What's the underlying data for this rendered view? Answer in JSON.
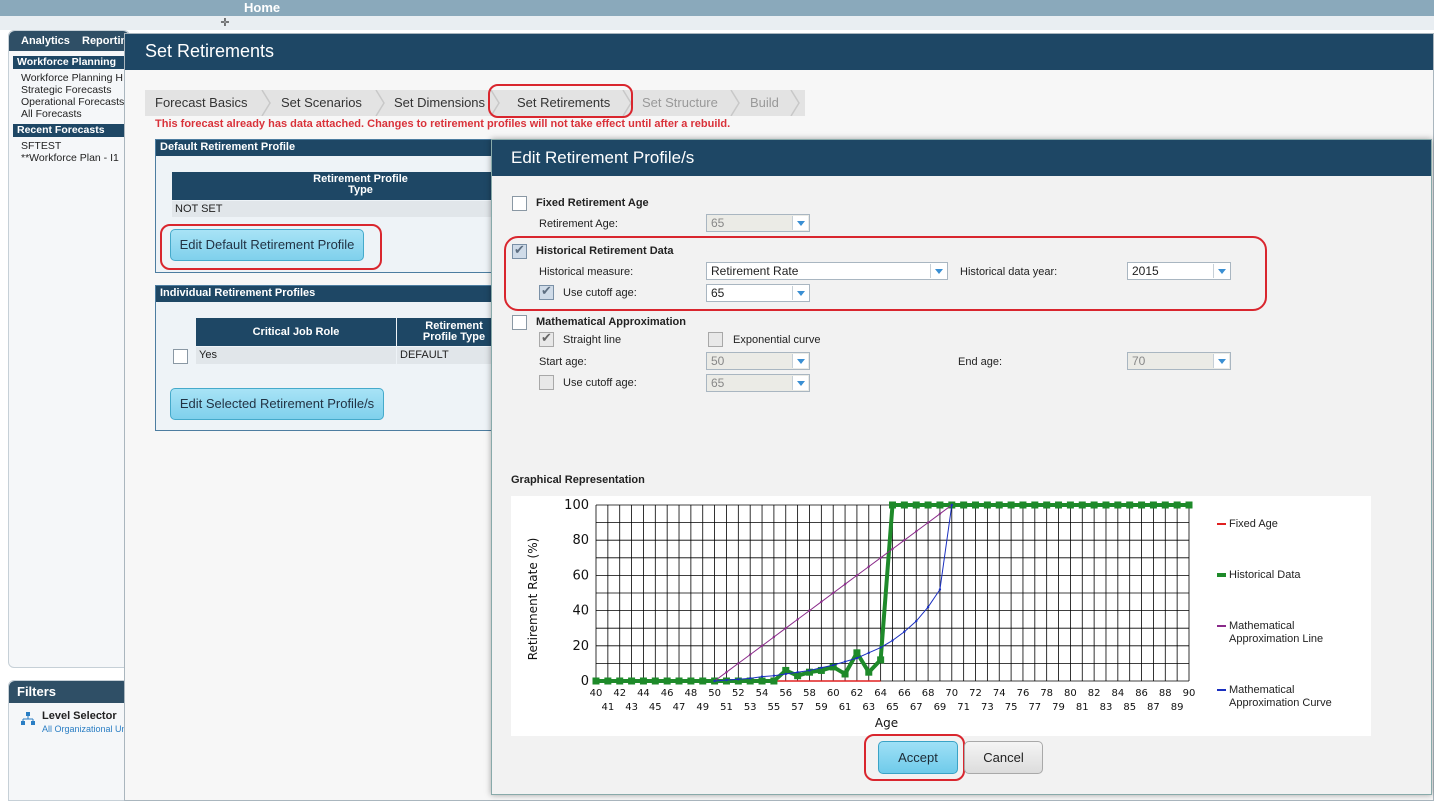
{
  "app": {
    "home_label": "Home"
  },
  "left_panel": {
    "tabs": [
      "Analytics",
      "Reporting"
    ],
    "section1_title": "Workforce Planning",
    "section1_items": [
      "Workforce Planning H",
      "Strategic Forecasts",
      "Operational Forecasts",
      "All Forecasts"
    ],
    "section2_title": "Recent Forecasts",
    "section2_items": [
      "SFTEST",
      "**Workforce Plan - I1"
    ]
  },
  "filters": {
    "title": "Filters",
    "level_selector_label": "Level Selector",
    "level_selector_value": "All Organizational Un"
  },
  "window": {
    "title": "Set Retirements",
    "breadcrumbs": [
      "Forecast Basics",
      "Set Scenarios",
      "Set Dimensions",
      "Set Retirements",
      "Set Structure",
      "Build"
    ],
    "warning": "This forecast already has data attached. Changes to retirement profiles will not take effect until after a rebuild."
  },
  "default_profile": {
    "title": "Default Retirement Profile",
    "column_header": "Retirement Profile Type",
    "value": "NOT SET",
    "button": "Edit Default Retirement Profile"
  },
  "individual_profiles": {
    "title": "Individual Retirement Profiles",
    "columns": [
      "Critical Job Role",
      "Retirement Profile Type"
    ],
    "rows": [
      {
        "role": "Yes",
        "type": "DEFAULT"
      }
    ],
    "button": "Edit Selected Retirement Profile/s"
  },
  "dialog": {
    "title": "Edit Retirement Profile/s",
    "fixed": {
      "label": "Fixed Retirement Age",
      "checked": false,
      "age_label": "Retirement Age:",
      "age_value": "65"
    },
    "historical": {
      "label": "Historical Retirement Data",
      "checked": true,
      "measure_label": "Historical measure:",
      "measure_value": "Retirement Rate",
      "year_label": "Historical data year:",
      "year_value": "2015",
      "cutoff_label": "Use cutoff age:",
      "cutoff_checked": true,
      "cutoff_value": "65"
    },
    "math": {
      "label": "Mathematical Approximation",
      "checked": false,
      "straight_label": "Straight line",
      "straight_checked": true,
      "exp_label": "Exponential curve",
      "exp_checked": false,
      "start_label": "Start age:",
      "start_value": "50",
      "end_label": "End age:",
      "end_value": "70",
      "cutoff_label": "Use cutoff age:",
      "cutoff_checked": false,
      "cutoff_value": "65"
    },
    "graph_title": "Graphical Representation",
    "accept_label": "Accept",
    "cancel_label": "Cancel"
  },
  "chart_data": {
    "type": "line",
    "xlabel": "Age",
    "ylabel": "Retirement Rate (%)",
    "xlim": [
      40,
      90
    ],
    "ylim": [
      0,
      100
    ],
    "yticks": [
      0,
      20,
      40,
      60,
      80,
      100
    ],
    "x": [
      40,
      41,
      42,
      43,
      44,
      45,
      46,
      47,
      48,
      49,
      50,
      51,
      52,
      53,
      54,
      55,
      56,
      57,
      58,
      59,
      60,
      61,
      62,
      63,
      64,
      65,
      66,
      67,
      68,
      69,
      70,
      71,
      72,
      73,
      74,
      75,
      76,
      77,
      78,
      79,
      80,
      81,
      82,
      83,
      84,
      85,
      86,
      87,
      88,
      89,
      90
    ],
    "series": [
      {
        "name": "Fixed Age",
        "color": "#e02020",
        "values": [
          0,
          0,
          0,
          0,
          0,
          0,
          0,
          0,
          0,
          0,
          0,
          0,
          0,
          0,
          0,
          0,
          0,
          0,
          0,
          0,
          0,
          0,
          0,
          0,
          0,
          null,
          null,
          null,
          null,
          null,
          null,
          null,
          null,
          null,
          null,
          null,
          null,
          null,
          null,
          null,
          null,
          null,
          null,
          null,
          null,
          null,
          null,
          null,
          null,
          null,
          null
        ]
      },
      {
        "name": "Historical Data",
        "color": "#1e8a2a",
        "values": [
          0,
          0,
          0,
          0,
          0,
          0,
          0,
          0,
          0,
          0,
          0,
          0,
          0,
          0,
          0,
          0,
          6,
          3,
          5,
          6,
          8,
          4,
          16,
          5,
          12,
          100,
          100,
          100,
          100,
          100,
          100,
          100,
          100,
          100,
          100,
          100,
          100,
          100,
          100,
          100,
          100,
          100,
          100,
          100,
          100,
          100,
          100,
          100,
          100,
          100,
          100
        ]
      },
      {
        "name": "Mathematical Approximation Line",
        "color": "#8a2a8a",
        "values": [
          null,
          null,
          null,
          null,
          null,
          null,
          null,
          null,
          null,
          null,
          0,
          5,
          10,
          15,
          20,
          25,
          30,
          35,
          40,
          45,
          50,
          55,
          60,
          65,
          70,
          75,
          80,
          85,
          90,
          95,
          100,
          null,
          null,
          null,
          null,
          null,
          null,
          null,
          null,
          null,
          null,
          null,
          null,
          null,
          null,
          null,
          null,
          null,
          null,
          null,
          null
        ]
      },
      {
        "name": "Mathematical Approximation Curve",
        "color": "#1a2fbf",
        "values": [
          null,
          null,
          null,
          null,
          null,
          null,
          null,
          null,
          null,
          null,
          0,
          0.5,
          1,
          1.5,
          2.5,
          3,
          4,
          5,
          6,
          7.5,
          9,
          11,
          13,
          16,
          19,
          23,
          28,
          34,
          42,
          52,
          100,
          null,
          null,
          null,
          null,
          null,
          null,
          null,
          null,
          null,
          null,
          null,
          null,
          null,
          null,
          null,
          null,
          null,
          null,
          null,
          null
        ]
      }
    ],
    "legend": [
      "Fixed Age",
      "Historical Data",
      "Mathematical Approximation Line",
      "Mathematical Approximation Curve"
    ]
  }
}
